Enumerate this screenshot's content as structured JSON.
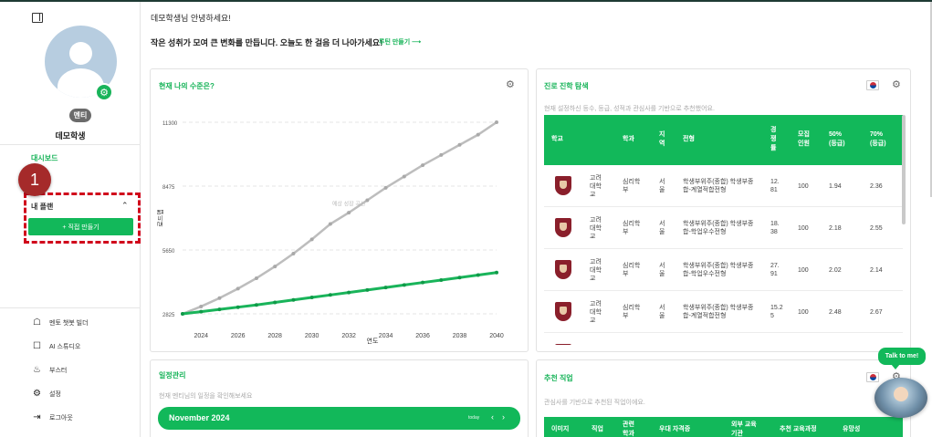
{
  "sidebar": {
    "role_badge": "멘티",
    "username": "데모학생",
    "nav": {
      "dashboard": "대시보드",
      "manage": "관리",
      "my_plan": "내 플랜",
      "make_button": "+ 직접 만들기"
    },
    "step_number": "1",
    "bottom": [
      {
        "label": "멘토 챗봇 빌더",
        "icon": "robot-icon"
      },
      {
        "label": "AI 스튜디오",
        "icon": "studio-icon"
      },
      {
        "label": "부스터",
        "icon": "booster-icon"
      },
      {
        "label": "설정",
        "icon": "gear-icon"
      },
      {
        "label": "로그아웃",
        "icon": "logout-icon"
      }
    ]
  },
  "header": {
    "greeting": "데모학생님 안녕하세요!",
    "headline": "작은 성취가 모여 큰 변화를 만듭니다. 오늘도 한 걸음 더 나아가세요!",
    "routine_link": "루틴 만들기 ⟶"
  },
  "level_card": {
    "title": "현재 나의 수준은?"
  },
  "chart_data": {
    "type": "line",
    "xlabel": "연도",
    "ylabel": "로드맵",
    "x": [
      2023,
      2024,
      2025,
      2026,
      2027,
      2028,
      2029,
      2030,
      2031,
      2032,
      2033,
      2034,
      2035,
      2036,
      2037,
      2038,
      2039,
      2040
    ],
    "xticks": [
      "2024",
      "2026",
      "2028",
      "2030",
      "2032",
      "2034",
      "2036",
      "2038",
      "2040"
    ],
    "yticks": [
      "2825",
      "5650",
      "8475",
      "11300"
    ],
    "ylim": [
      2825,
      11300
    ],
    "annotation": "예상 성장 곡선",
    "series": [
      {
        "color": "#bdbdbd",
        "values": [
          2825,
          3150,
          3520,
          3940,
          4400,
          4920,
          5490,
          6120,
          6800,
          7300,
          7850,
          8400,
          8900,
          9400,
          9850,
          10300,
          10750,
          11300
        ]
      },
      {
        "color": "#19b45a",
        "values": [
          2825,
          2920,
          3020,
          3120,
          3220,
          3330,
          3440,
          3550,
          3660,
          3770,
          3880,
          3990,
          4100,
          4210,
          4320,
          4430,
          4540,
          4650
        ]
      }
    ],
    "grid": true
  },
  "career_card": {
    "title": "진로 진학 탐색",
    "subtitle": "현재 설정하신 등수, 등급, 성적과 관심사를 기반으로 추천했어요.",
    "columns": [
      {
        "key": "school",
        "label": "학교"
      },
      {
        "key": "dept",
        "label": "학과"
      },
      {
        "key": "region",
        "label": "지\n역"
      },
      {
        "key": "type",
        "label": "전형"
      },
      {
        "key": "rate",
        "label": "경\n쟁\n률"
      },
      {
        "key": "quota",
        "label": "모집\n인원"
      },
      {
        "key": "p50",
        "label": "50%\n(등급)"
      },
      {
        "key": "p70",
        "label": "70%\n(등급)"
      }
    ],
    "rows": [
      {
        "school": "고려\n대학\n교",
        "dept": "심리학\n부",
        "region": "서\n울",
        "type": "학생부위주(종합) 학생부종\n합-계열적합전형",
        "rate": "12.\n81",
        "quota": "100",
        "p50": "1.94",
        "p70": "2.36"
      },
      {
        "school": "고려\n대학\n교",
        "dept": "심리학\n부",
        "region": "서\n울",
        "type": "학생부위주(종합) 학생부종\n합-학업우수전형",
        "rate": "18.\n38",
        "quota": "100",
        "p50": "2.18",
        "p70": "2.55"
      },
      {
        "school": "고려\n대학\n교",
        "dept": "심리학\n부",
        "region": "서\n울",
        "type": "학생부위주(종합) 학생부종\n합-학업우수전형",
        "rate": "27.\n91",
        "quota": "100",
        "p50": "2.02",
        "p70": "2.14"
      },
      {
        "school": "고려\n대학\n교",
        "dept": "심리학\n부",
        "region": "서\n울",
        "type": "학생부위주(종합) 학생부종\n합-계열적합전형",
        "rate": "15.2\n5",
        "quota": "100",
        "p50": "2.48",
        "p70": "2.67"
      },
      {
        "school": "고려",
        "dept": "",
        "region": "",
        "type": "",
        "rate": "",
        "quota": "",
        "p50": "",
        "p70": ""
      }
    ]
  },
  "schedule_card": {
    "title": "일정관리",
    "subtitle": "현재 멘티님의 일정을 확인해보세요",
    "month": "November 2024",
    "today": "today",
    "prev": "‹",
    "next": "›"
  },
  "jobs_card": {
    "title": "추천 직업",
    "subtitle": "관심사를 기반으로 추천된 직업이에요.",
    "columns": [
      "이미지",
      "직업",
      "관련\n학과",
      "우대 자격증",
      "외부 교육\n기관",
      "추천 교육과정",
      "유망성"
    ]
  },
  "chatbot": {
    "bubble": "Talk to me!"
  }
}
